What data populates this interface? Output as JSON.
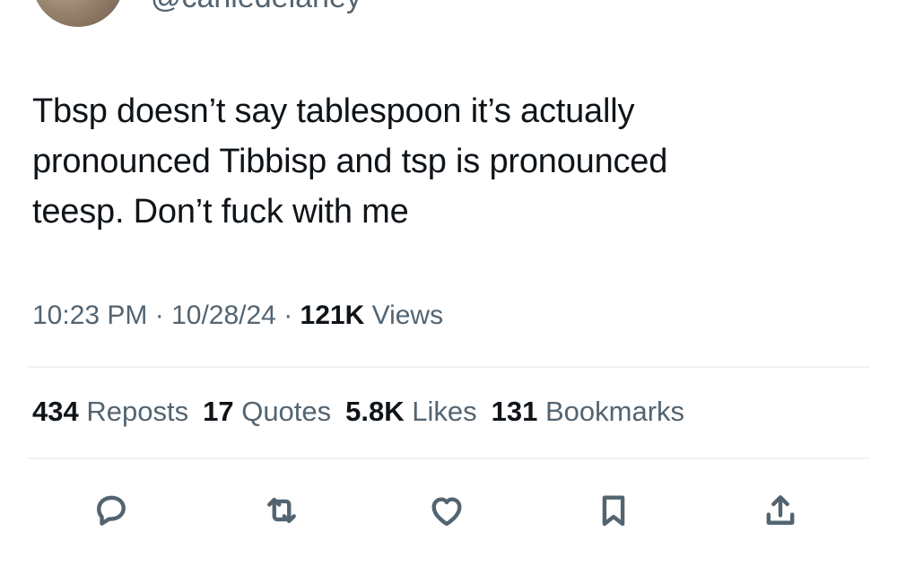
{
  "author": {
    "handle": "@carliedelaney"
  },
  "tweet": {
    "lines": [
      "Tbsp doesn’t say tablespoon it’s actually",
      "pronounced Tibbisp and tsp is pronounced",
      "teesp. Don’t fuck with me"
    ],
    "time": "10:23 PM",
    "date": "10/28/24",
    "separator": " · ",
    "views_count": "121K",
    "views_label": "Views"
  },
  "stats": {
    "reposts": {
      "count": "434",
      "label": "Reposts"
    },
    "quotes": {
      "count": "17",
      "label": "Quotes"
    },
    "likes": {
      "count": "5.8K",
      "label": "Likes"
    },
    "bookmarks": {
      "count": "131",
      "label": "Bookmarks"
    }
  },
  "actions": {
    "icons": [
      "reply-icon",
      "repost-icon",
      "like-icon",
      "bookmark-icon",
      "share-icon"
    ],
    "icon_color": "#536471"
  }
}
